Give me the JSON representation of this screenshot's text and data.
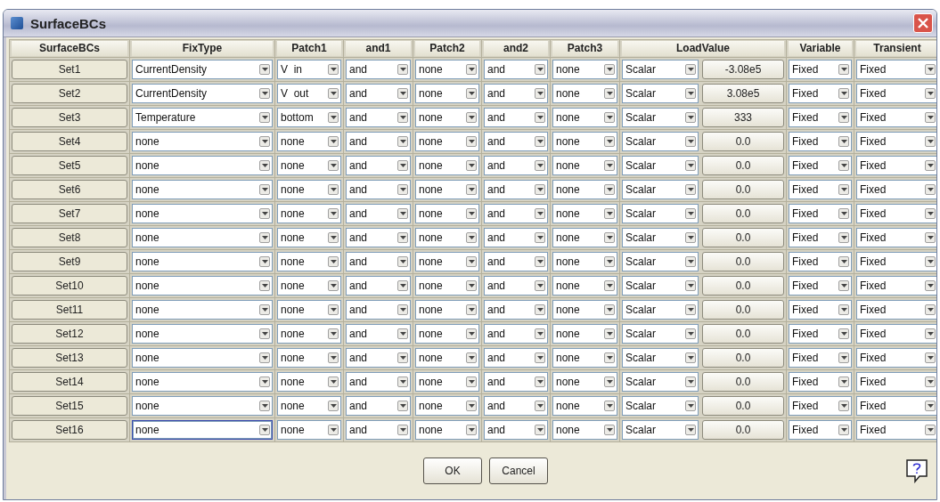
{
  "window": {
    "title": "SurfaceBCs"
  },
  "columns": [
    "SurfaceBCs",
    "FixType",
    "Patch1",
    "and1",
    "Patch2",
    "and2",
    "Patch3",
    "LoadValue",
    "Variable",
    "Transient"
  ],
  "rows": [
    {
      "set": "Set1",
      "fixtype": "CurrentDensity",
      "focused": false,
      "patch1": "V  in",
      "and1": "and",
      "patch2": "none",
      "and2": "and",
      "patch3": "none",
      "load_type": "Scalar",
      "load_value": "-3.08e5",
      "variable": "Fixed",
      "transient": "Fixed"
    },
    {
      "set": "Set2",
      "fixtype": "CurrentDensity",
      "focused": false,
      "patch1": "V  out",
      "and1": "and",
      "patch2": "none",
      "and2": "and",
      "patch3": "none",
      "load_type": "Scalar",
      "load_value": "3.08e5",
      "variable": "Fixed",
      "transient": "Fixed"
    },
    {
      "set": "Set3",
      "fixtype": "Temperature",
      "focused": false,
      "patch1": "bottom",
      "and1": "and",
      "patch2": "none",
      "and2": "and",
      "patch3": "none",
      "load_type": "Scalar",
      "load_value": "333",
      "variable": "Fixed",
      "transient": "Fixed"
    },
    {
      "set": "Set4",
      "fixtype": "none",
      "focused": false,
      "patch1": "none",
      "and1": "and",
      "patch2": "none",
      "and2": "and",
      "patch3": "none",
      "load_type": "Scalar",
      "load_value": "0.0",
      "variable": "Fixed",
      "transient": "Fixed"
    },
    {
      "set": "Set5",
      "fixtype": "none",
      "focused": false,
      "patch1": "none",
      "and1": "and",
      "patch2": "none",
      "and2": "and",
      "patch3": "none",
      "load_type": "Scalar",
      "load_value": "0.0",
      "variable": "Fixed",
      "transient": "Fixed"
    },
    {
      "set": "Set6",
      "fixtype": "none",
      "focused": false,
      "patch1": "none",
      "and1": "and",
      "patch2": "none",
      "and2": "and",
      "patch3": "none",
      "load_type": "Scalar",
      "load_value": "0.0",
      "variable": "Fixed",
      "transient": "Fixed"
    },
    {
      "set": "Set7",
      "fixtype": "none",
      "focused": false,
      "patch1": "none",
      "and1": "and",
      "patch2": "none",
      "and2": "and",
      "patch3": "none",
      "load_type": "Scalar",
      "load_value": "0.0",
      "variable": "Fixed",
      "transient": "Fixed"
    },
    {
      "set": "Set8",
      "fixtype": "none",
      "focused": false,
      "patch1": "none",
      "and1": "and",
      "patch2": "none",
      "and2": "and",
      "patch3": "none",
      "load_type": "Scalar",
      "load_value": "0.0",
      "variable": "Fixed",
      "transient": "Fixed"
    },
    {
      "set": "Set9",
      "fixtype": "none",
      "focused": false,
      "patch1": "none",
      "and1": "and",
      "patch2": "none",
      "and2": "and",
      "patch3": "none",
      "load_type": "Scalar",
      "load_value": "0.0",
      "variable": "Fixed",
      "transient": "Fixed"
    },
    {
      "set": "Set10",
      "fixtype": "none",
      "focused": false,
      "patch1": "none",
      "and1": "and",
      "patch2": "none",
      "and2": "and",
      "patch3": "none",
      "load_type": "Scalar",
      "load_value": "0.0",
      "variable": "Fixed",
      "transient": "Fixed"
    },
    {
      "set": "Set11",
      "fixtype": "none",
      "focused": false,
      "patch1": "none",
      "and1": "and",
      "patch2": "none",
      "and2": "and",
      "patch3": "none",
      "load_type": "Scalar",
      "load_value": "0.0",
      "variable": "Fixed",
      "transient": "Fixed"
    },
    {
      "set": "Set12",
      "fixtype": "none",
      "focused": false,
      "patch1": "none",
      "and1": "and",
      "patch2": "none",
      "and2": "and",
      "patch3": "none",
      "load_type": "Scalar",
      "load_value": "0.0",
      "variable": "Fixed",
      "transient": "Fixed"
    },
    {
      "set": "Set13",
      "fixtype": "none",
      "focused": false,
      "patch1": "none",
      "and1": "and",
      "patch2": "none",
      "and2": "and",
      "patch3": "none",
      "load_type": "Scalar",
      "load_value": "0.0",
      "variable": "Fixed",
      "transient": "Fixed"
    },
    {
      "set": "Set14",
      "fixtype": "none",
      "focused": false,
      "patch1": "none",
      "and1": "and",
      "patch2": "none",
      "and2": "and",
      "patch3": "none",
      "load_type": "Scalar",
      "load_value": "0.0",
      "variable": "Fixed",
      "transient": "Fixed"
    },
    {
      "set": "Set15",
      "fixtype": "none",
      "focused": false,
      "patch1": "none",
      "and1": "and",
      "patch2": "none",
      "and2": "and",
      "patch3": "none",
      "load_type": "Scalar",
      "load_value": "0.0",
      "variable": "Fixed",
      "transient": "Fixed"
    },
    {
      "set": "Set16",
      "fixtype": "none",
      "focused": true,
      "patch1": "none",
      "and1": "and",
      "patch2": "none",
      "and2": "and",
      "patch3": "none",
      "load_type": "Scalar",
      "load_value": "0.0",
      "variable": "Fixed",
      "transient": "Fixed"
    }
  ],
  "buttons": [
    "OK",
    "Cancel"
  ]
}
